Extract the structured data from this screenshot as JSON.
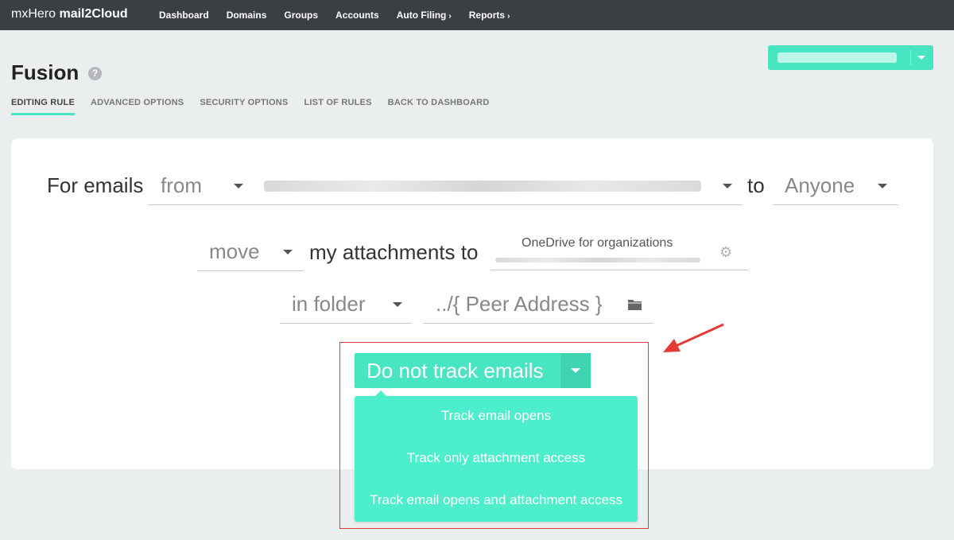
{
  "app": {
    "brand_light": "mxHero",
    "brand_bold": "mail2Cloud"
  },
  "nav": {
    "items": [
      {
        "label": "Dashboard",
        "chevron": ""
      },
      {
        "label": "Domains",
        "chevron": ""
      },
      {
        "label": "Groups",
        "chevron": ""
      },
      {
        "label": "Accounts",
        "chevron": ""
      },
      {
        "label": "Auto Filing",
        "chevron": "›"
      },
      {
        "label": "Reports",
        "chevron": "›"
      }
    ]
  },
  "page": {
    "title": "Fusion",
    "help_icon": "?"
  },
  "tabs": [
    {
      "label": "EDITING RULE",
      "active": true
    },
    {
      "label": "ADVANCED OPTIONS",
      "active": false
    },
    {
      "label": "SECURITY OPTIONS",
      "active": false
    },
    {
      "label": "LIST OF RULES",
      "active": false
    },
    {
      "label": "BACK TO DASHBOARD",
      "active": false
    }
  ],
  "rule": {
    "for_emails_label": "For emails",
    "direction_value": "from",
    "to_label": "to",
    "recipient_value": "Anyone",
    "action_value": "move",
    "attachments_label": "my attachments to",
    "storage_value": "OneDrive for organizations",
    "folder_mode_value": "in folder",
    "folder_path_value": "../{ Peer Address }"
  },
  "tracking": {
    "selected_label": "Do not track emails",
    "options": [
      "Track email opens",
      "Track only attachment access",
      "Track email opens and attachment access"
    ]
  },
  "colors": {
    "accent": "#48e5c2",
    "topbar": "#3a3f44",
    "annotation": "#e03a3a"
  }
}
